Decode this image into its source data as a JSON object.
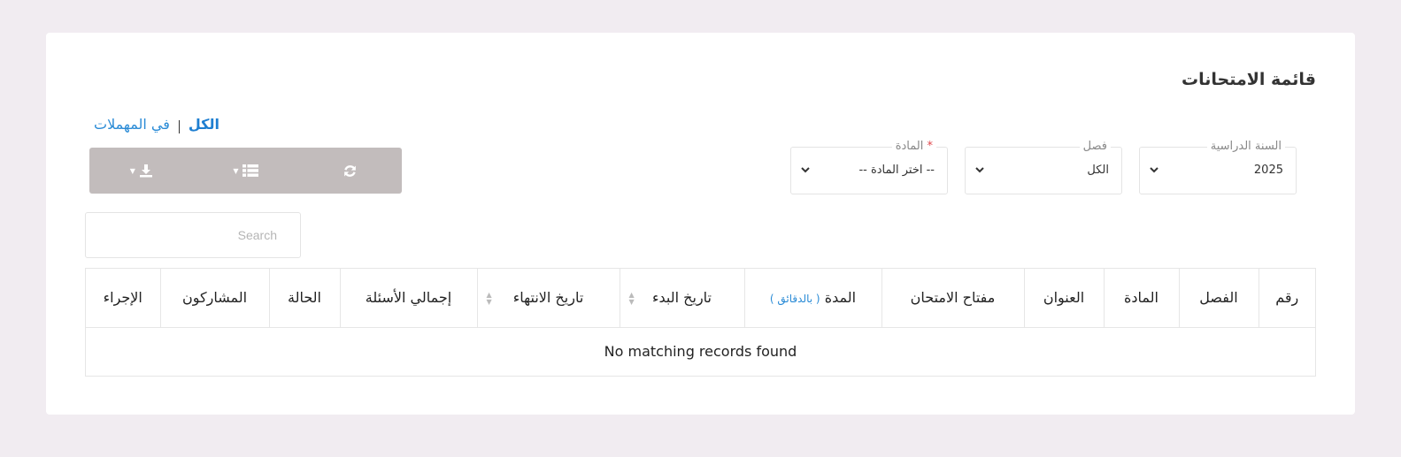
{
  "page": {
    "title": "قائمة الامتحانات"
  },
  "tabs": [
    {
      "label": "الكل",
      "active": true
    },
    {
      "label": "في المهملات",
      "active": false
    }
  ],
  "toolbar": {
    "buttons": [
      {
        "icon": "refresh-icon"
      },
      {
        "icon": "columns-list-icon",
        "dropdown": true
      },
      {
        "icon": "download-icon",
        "dropdown": true
      }
    ],
    "background": "#c2bcbc"
  },
  "filters": {
    "year": {
      "label": "السنة الدراسية",
      "value": "2025"
    },
    "class": {
      "label": "فصل",
      "value": "الكل"
    },
    "subject": {
      "label": "المادة",
      "required_mark": "*",
      "value": "-- اختر المادة --"
    }
  },
  "search": {
    "placeholder": "Search",
    "value": ""
  },
  "table": {
    "columns": [
      {
        "label": "رقم"
      },
      {
        "label": "الفصل"
      },
      {
        "label": "المادة"
      },
      {
        "label": "العنوان"
      },
      {
        "label": "مفتاح الامتحان"
      },
      {
        "label": "المدة",
        "unit": "( بالدقائق )"
      },
      {
        "label": "تاريخ البدء",
        "sortable": true
      },
      {
        "label": "تاريخ الانتهاء",
        "sortable": true
      },
      {
        "label": "إجمالي الأسئلة"
      },
      {
        "label": "الحالة"
      },
      {
        "label": "المشاركون"
      },
      {
        "label": "الإجراء"
      }
    ],
    "empty_message": "No matching records found"
  },
  "colors": {
    "accent": "#2a8bd6",
    "required": "#e0474c",
    "page_bg": "#f1ecf1"
  }
}
